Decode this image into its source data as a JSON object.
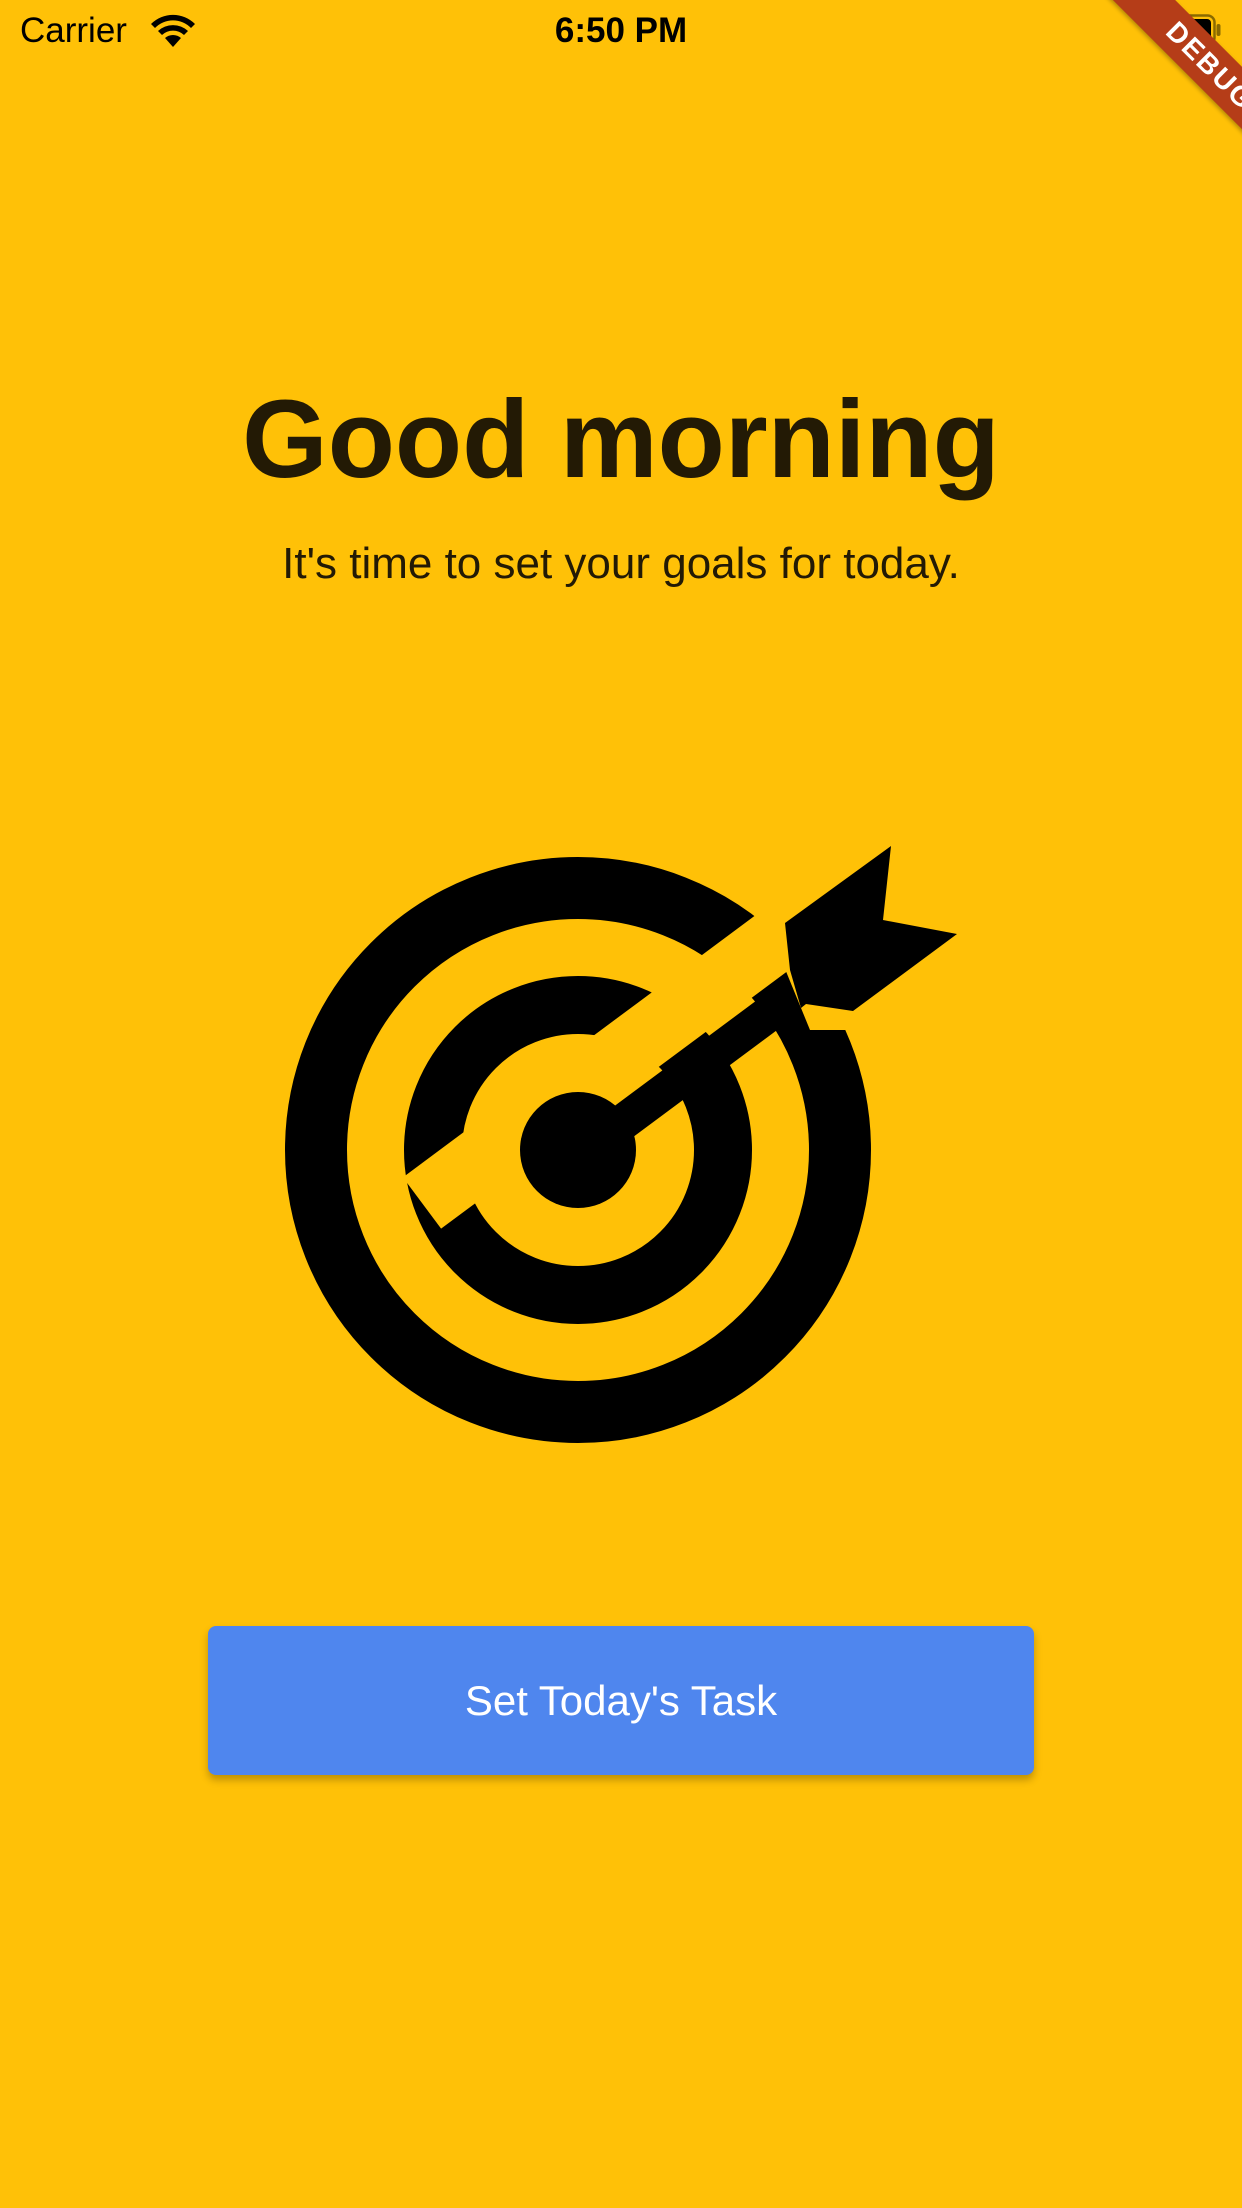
{
  "status_bar": {
    "carrier": "Carrier",
    "time": "6:50 PM",
    "wifi_icon": "wifi-icon",
    "battery_icon": "battery-icon"
  },
  "debug_banner": {
    "label": "DEBUG",
    "color": "#B53D18"
  },
  "main": {
    "title": "Good morning",
    "subtitle": "It's time to set your goals for today.",
    "illustration_icon": "target-arrow-icon",
    "cta_label": "Set Today's Task"
  },
  "colors": {
    "background": "#FFC107",
    "button": "#4F86EE",
    "text": "#231A05"
  }
}
